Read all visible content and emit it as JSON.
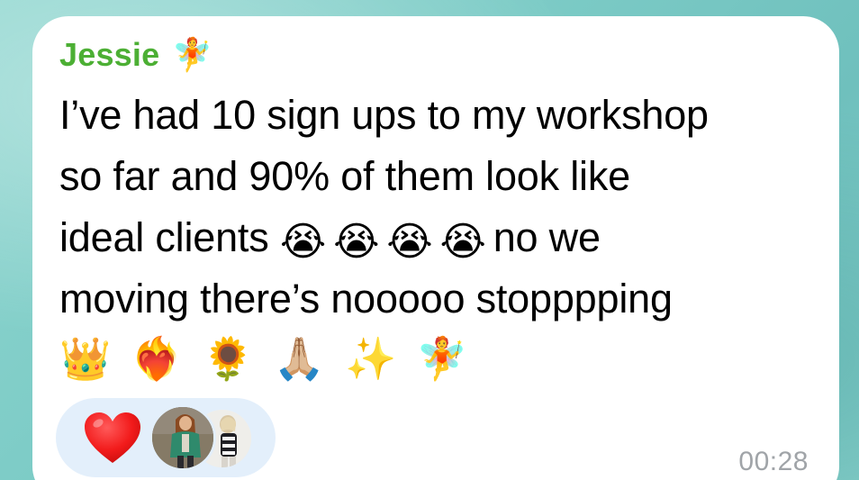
{
  "message": {
    "sender_name": "Jessie",
    "sender_emoji": "🧚",
    "lines": [
      "I’ve had 10 sign ups to my workshop",
      "so far and 90% of them look like"
    ],
    "line3_start": "ideal clients",
    "line3_emojis": [
      "😭",
      "😭",
      "😭",
      "😭"
    ],
    "line3_end": "no we",
    "line4": "moving there’s nooooo stopppping",
    "trailing_emojis": [
      "👑",
      "❤️‍🔥",
      "🌻",
      "🙏🏼",
      "✨",
      "🧚"
    ],
    "timestamp": "00:28"
  },
  "reactions": {
    "emoji": "heart",
    "color": "#f21b1b",
    "reactor_count": 2
  },
  "colors": {
    "sender_name": "#4caf34",
    "bubble": "#ffffff",
    "reaction_pill": "#e3effb",
    "timestamp": "#a0a4a8"
  }
}
